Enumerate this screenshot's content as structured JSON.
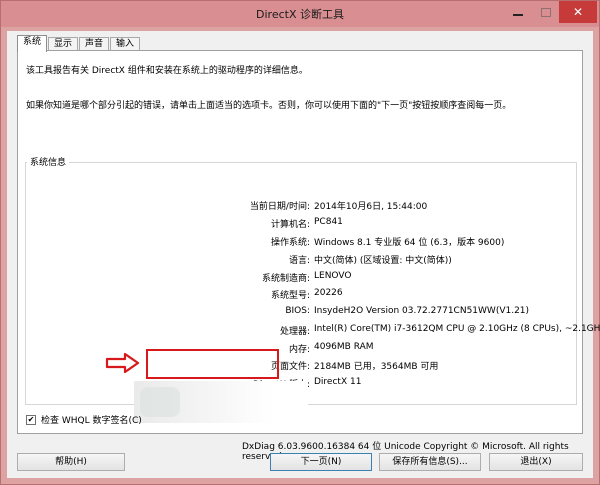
{
  "window": {
    "title": "DirectX 诊断工具"
  },
  "tabs": [
    {
      "label": "系统"
    },
    {
      "label": "显示"
    },
    {
      "label": "声音"
    },
    {
      "label": "输入"
    }
  ],
  "intro": {
    "line1": "该工具报告有关 DirectX 组件和安装在系统上的驱动程序的详细信息。",
    "line2": "如果你知道是哪个部分引起的错误，请单击上面适当的选项卡。否则，你可以使用下面的\"下一页\"按钮按顺序查阅每一页。"
  },
  "system_info": {
    "group_title": "系统信息",
    "rows": [
      {
        "key": "当前日期/时间:",
        "value": "2014年10月6日, 15:44:00"
      },
      {
        "key": "计算机名:",
        "value": "PC841"
      },
      {
        "key": "操作系统:",
        "value": "Windows 8.1 专业版 64 位 (6.3，版本 9600)"
      },
      {
        "key": "语言:",
        "value": "中文(简体) (区域设置: 中文(简体))"
      },
      {
        "key": "系统制造商:",
        "value": "LENOVO"
      },
      {
        "key": "系统型号:",
        "value": "20226"
      },
      {
        "key": "BIOS:",
        "value": "InsydeH2O Version 03.72.2771CN51WW(V1.21)"
      },
      {
        "key": "处理器:",
        "value": "Intel(R) Core(TM) i7-3612QM CPU @ 2.10GHz (8 CPUs), ~2.1GHz"
      },
      {
        "key": "内存:",
        "value": "4096MB RAM"
      },
      {
        "key": "页面文件:",
        "value": "2184MB 已用，3564MB 可用"
      },
      {
        "key": "DirectX 版本:",
        "value": "DirectX 11"
      }
    ]
  },
  "whql": {
    "checked_mark": "✔",
    "label": "检查 WHQL 数字签名(C)"
  },
  "footer": {
    "info": "DxDiag 6.03.9600.16384 64 位 Unicode  Copyright © Microsoft. All rights reserved."
  },
  "buttons": {
    "help": "帮助(H)",
    "next": "下一页(N)",
    "save": "保存所有信息(S)...",
    "exit": "退出(X)"
  },
  "colors": {
    "titlebar": "#d98f92",
    "close_button": "#c63a3a",
    "highlight_box": "#d8191c"
  }
}
